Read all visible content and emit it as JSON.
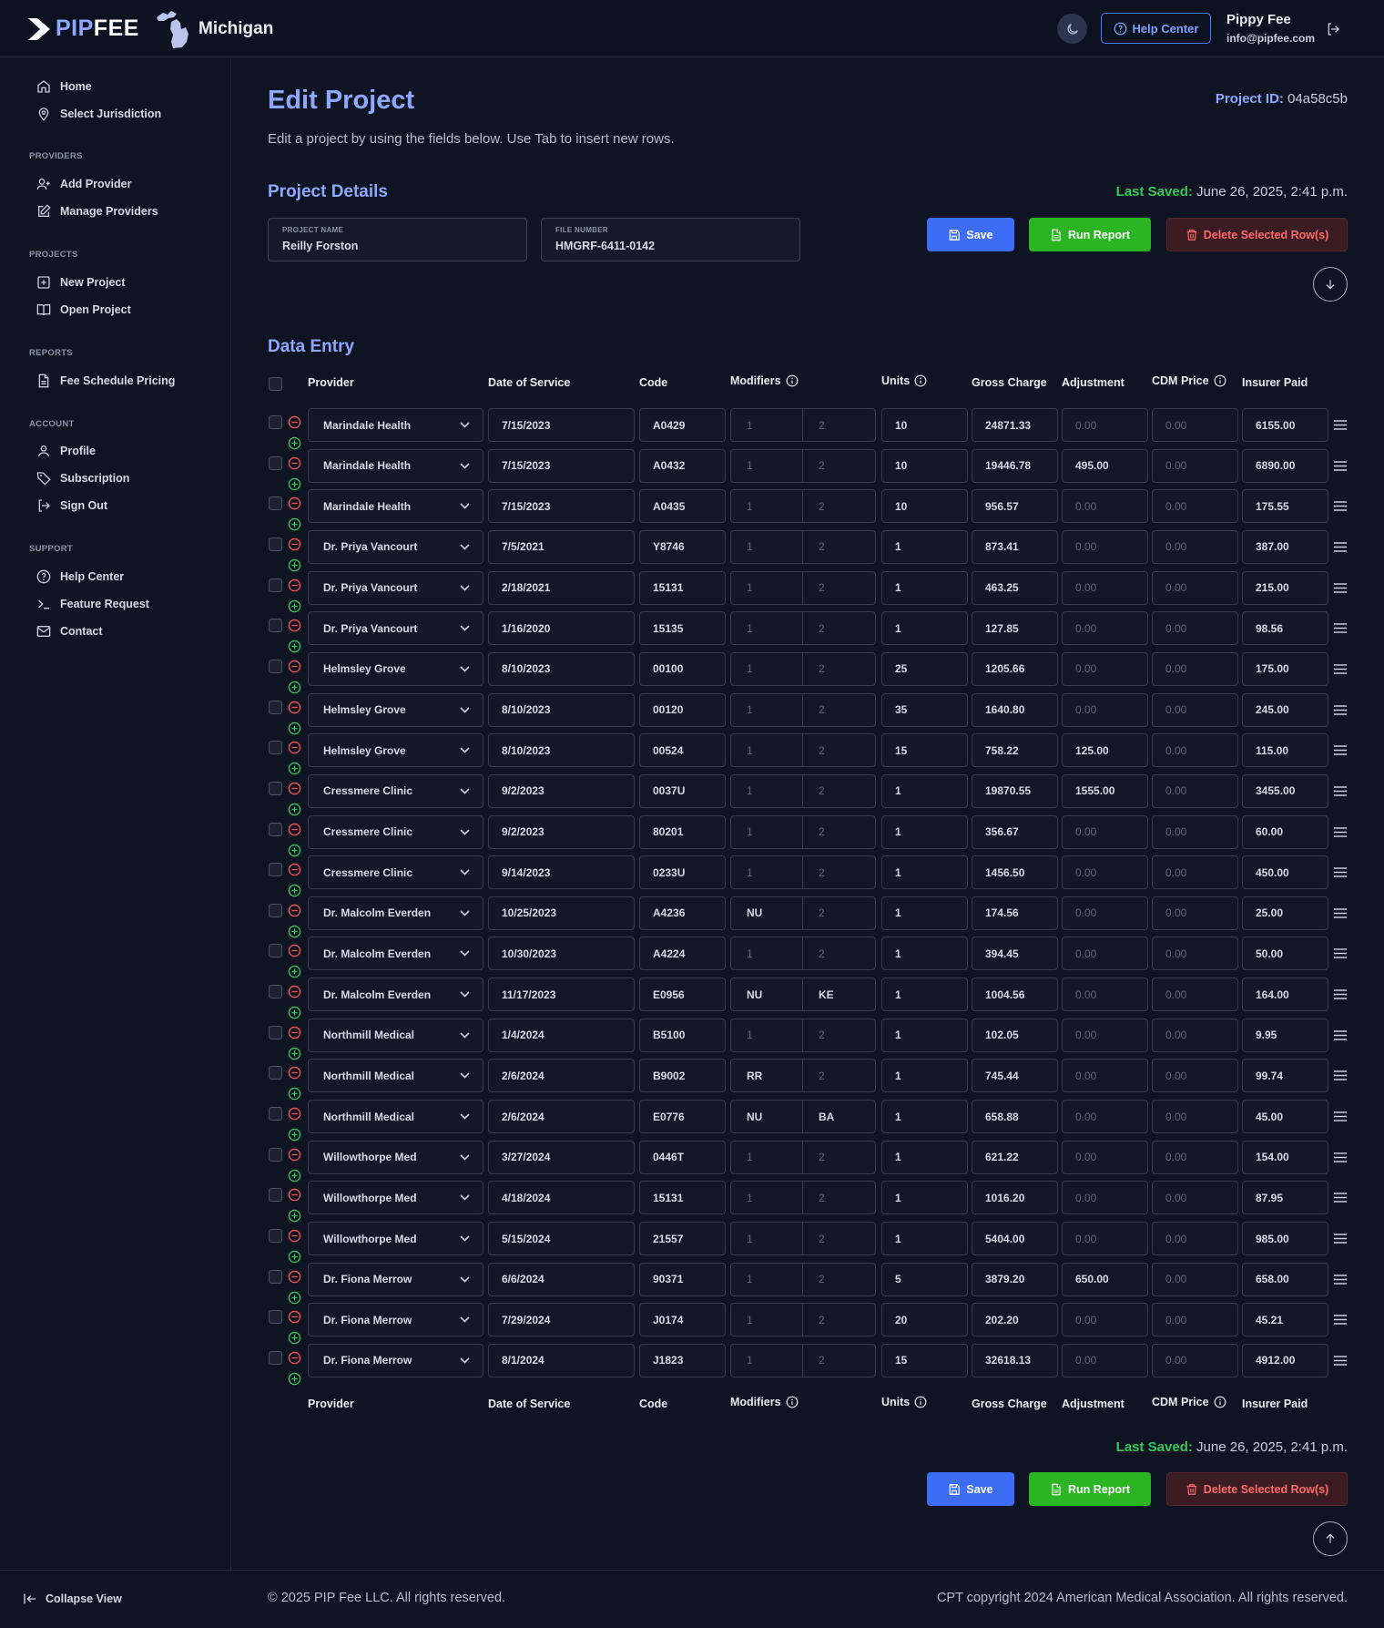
{
  "header": {
    "brand_prefix": "PIP",
    "brand_suffix": "FEE",
    "state": "Michigan",
    "help_label": "Help Center",
    "user_name": "Pippy Fee",
    "user_email": "info@pipfee.com"
  },
  "sidebar": {
    "top": [
      {
        "label": "Home",
        "icon": "home-icon"
      },
      {
        "label": "Select Jurisdiction",
        "icon": "map-pin-icon"
      }
    ],
    "providers_title": "PROVIDERS",
    "providers": [
      {
        "label": "Add Provider",
        "icon": "user-plus-icon"
      },
      {
        "label": "Manage Providers",
        "icon": "edit-icon"
      }
    ],
    "projects_title": "PROJECTS",
    "projects": [
      {
        "label": "New Project",
        "icon": "plus-square-icon"
      },
      {
        "label": "Open Project",
        "icon": "book-open-icon"
      }
    ],
    "reports_title": "REPORTS",
    "reports": [
      {
        "label": "Fee Schedule Pricing",
        "icon": "file-text-icon"
      }
    ],
    "account_title": "ACCOUNT",
    "account": [
      {
        "label": "Profile",
        "icon": "user-icon"
      },
      {
        "label": "Subscription",
        "icon": "tag-icon"
      },
      {
        "label": "Sign Out",
        "icon": "sign-out-icon"
      }
    ],
    "support_title": "SUPPORT",
    "support": [
      {
        "label": "Help Center",
        "icon": "help-circle-icon"
      },
      {
        "label": "Feature Request",
        "icon": "terminal-icon"
      },
      {
        "label": "Contact",
        "icon": "mail-icon"
      }
    ],
    "collapse_label": "Collapse View"
  },
  "page": {
    "title": "Edit Project",
    "subtitle": "Edit a project by using the fields below. Use Tab to insert new rows.",
    "project_id_label": "Project ID:",
    "project_id": "04a58c5b",
    "details_title": "Project Details",
    "last_saved_label": "Last Saved:",
    "last_saved": "June 26, 2025, 2:41 p.m.",
    "project_name_label": "PROJECT NAME",
    "project_name": "Reilly Forston",
    "file_number_label": "FILE NUMBER",
    "file_number": "HMGRF-6411-0142",
    "save_label": "Save",
    "run_label": "Run Report",
    "delete_label": "Delete Selected Row(s)",
    "data_entry_title": "Data Entry"
  },
  "columns": {
    "provider": "Provider",
    "dos": "Date of Service",
    "code": "Code",
    "modifiers": "Modifiers",
    "units": "Units",
    "gross": "Gross Charge",
    "adjustment": "Adjustment",
    "cdm": "CDM Price",
    "insurer": "Insurer Paid"
  },
  "placeholders": {
    "mod1": "1",
    "mod2": "2",
    "amount": "0.00"
  },
  "rows": [
    [
      "Marindale Health",
      "7/15/2023",
      "A0429",
      "",
      "",
      "10",
      "24871.33",
      "",
      "",
      "6155.00"
    ],
    [
      "Marindale Health",
      "7/15/2023",
      "A0432",
      "",
      "",
      "10",
      "19446.78",
      "495.00",
      "",
      "6890.00"
    ],
    [
      "Marindale Health",
      "7/15/2023",
      "A0435",
      "",
      "",
      "10",
      "956.57",
      "",
      "",
      "175.55"
    ],
    [
      "Dr. Priya Vancourt",
      "7/5/2021",
      "Y8746",
      "",
      "",
      "1",
      "873.41",
      "",
      "",
      "387.00"
    ],
    [
      "Dr. Priya Vancourt",
      "2/18/2021",
      "15131",
      "",
      "",
      "1",
      "463.25",
      "",
      "",
      "215.00"
    ],
    [
      "Dr. Priya Vancourt",
      "1/16/2020",
      "15135",
      "",
      "",
      "1",
      "127.85",
      "",
      "",
      "98.56"
    ],
    [
      "Helmsley Grove",
      "8/10/2023",
      "00100",
      "",
      "",
      "25",
      "1205.66",
      "",
      "",
      "175.00"
    ],
    [
      "Helmsley Grove",
      "8/10/2023",
      "00120",
      "",
      "",
      "35",
      "1640.80",
      "",
      "",
      "245.00"
    ],
    [
      "Helmsley Grove",
      "8/10/2023",
      "00524",
      "",
      "",
      "15",
      "758.22",
      "125.00",
      "",
      "115.00"
    ],
    [
      "Cressmere Clinic",
      "9/2/2023",
      "0037U",
      "",
      "",
      "1",
      "19870.55",
      "1555.00",
      "",
      "3455.00"
    ],
    [
      "Cressmere Clinic",
      "9/2/2023",
      "80201",
      "",
      "",
      "1",
      "356.67",
      "",
      "",
      "60.00"
    ],
    [
      "Cressmere Clinic",
      "9/14/2023",
      "0233U",
      "",
      "",
      "1",
      "1456.50",
      "",
      "",
      "450.00"
    ],
    [
      "Dr. Malcolm Everden",
      "10/25/2023",
      "A4236",
      "NU",
      "",
      "1",
      "174.56",
      "",
      "",
      "25.00"
    ],
    [
      "Dr. Malcolm Everden",
      "10/30/2023",
      "A4224",
      "",
      "",
      "1",
      "394.45",
      "",
      "",
      "50.00"
    ],
    [
      "Dr. Malcolm Everden",
      "11/17/2023",
      "E0956",
      "NU",
      "KE",
      "1",
      "1004.56",
      "",
      "",
      "164.00"
    ],
    [
      "Northmill Medical",
      "1/4/2024",
      "B5100",
      "",
      "",
      "1",
      "102.05",
      "",
      "",
      "9.95"
    ],
    [
      "Northmill Medical",
      "2/6/2024",
      "B9002",
      "RR",
      "",
      "1",
      "745.44",
      "",
      "",
      "99.74"
    ],
    [
      "Northmill Medical",
      "2/6/2024",
      "E0776",
      "NU",
      "BA",
      "1",
      "658.88",
      "",
      "",
      "45.00"
    ],
    [
      "Willowthorpe Med",
      "3/27/2024",
      "0446T",
      "",
      "",
      "1",
      "621.22",
      "",
      "",
      "154.00"
    ],
    [
      "Willowthorpe Med",
      "4/18/2024",
      "15131",
      "",
      "",
      "1",
      "1016.20",
      "",
      "",
      "87.95"
    ],
    [
      "Willowthorpe Med",
      "5/15/2024",
      "21557",
      "",
      "",
      "1",
      "5404.00",
      "",
      "",
      "985.00"
    ],
    [
      "Dr. Fiona Merrow",
      "6/6/2024",
      "90371",
      "",
      "",
      "5",
      "3879.20",
      "650.00",
      "",
      "658.00"
    ],
    [
      "Dr. Fiona Merrow",
      "7/29/2024",
      "J0174",
      "",
      "",
      "20",
      "202.20",
      "",
      "",
      "45.21"
    ],
    [
      "Dr. Fiona Merrow",
      "8/1/2024",
      "J1823",
      "",
      "",
      "15",
      "32618.13",
      "",
      "",
      "4912.00"
    ]
  ],
  "footer": {
    "copyright": "© 2025 PIP Fee LLC. All rights reserved.",
    "cpt": "CPT copyright 2024 American Medical Association. All rights reserved."
  },
  "colors": {
    "accent": "#8ea8ff",
    "save": "#3d6df5",
    "run": "#2cb522",
    "delete": "#ff6b6b",
    "saved": "#35c759"
  }
}
